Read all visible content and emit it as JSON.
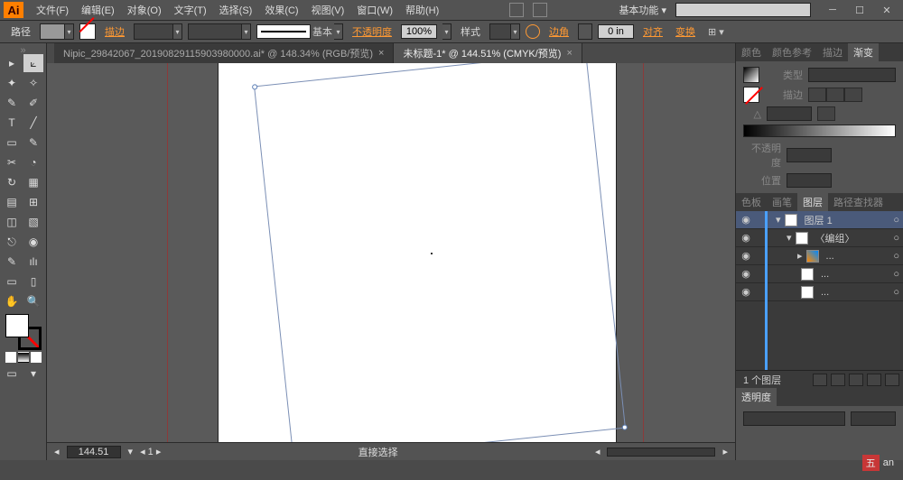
{
  "app": {
    "logo": "Ai"
  },
  "menu": {
    "items": [
      "文件(F)",
      "编辑(E)",
      "对象(O)",
      "文字(T)",
      "选择(S)",
      "效果(C)",
      "视图(V)",
      "窗口(W)",
      "帮助(H)"
    ],
    "workspace": "基本功能"
  },
  "options": {
    "label": "路径",
    "fill_link": "描边",
    "stroke_style": "基本",
    "opacity_label": "不透明度",
    "opacity": "100%",
    "style_label": "样式",
    "align_label": "边角",
    "align_val": "0 in",
    "align_link": "对齐",
    "transform_link": "变换"
  },
  "tabs": [
    {
      "label": "Nipic_29842067_20190829115903980000.ai* @ 148.34% (RGB/预览)",
      "active": false
    },
    {
      "label": "未标题-1* @ 144.51% (CMYK/预览)",
      "active": true
    }
  ],
  "status": {
    "zoom": "144.51",
    "tool": "直接选择"
  },
  "panels": {
    "color_tabs": [
      "颜色",
      "颜色参考",
      "描边",
      "渐变"
    ],
    "grad": {
      "type_label": "类型",
      "stroke_label": "描边"
    },
    "opacity_label": "不透明度",
    "position_label": "位置",
    "layer_tabs": [
      "色板",
      "画笔",
      "图层",
      "路径查找器"
    ],
    "layers": [
      {
        "name": "图层 1",
        "selected": true,
        "indent": 0,
        "expand": true
      },
      {
        "name": "〈编组〉",
        "selected": false,
        "indent": 1,
        "expand": true
      },
      {
        "name": "...",
        "selected": false,
        "indent": 2
      },
      {
        "name": "...",
        "selected": false,
        "indent": 2
      },
      {
        "name": "...",
        "selected": false,
        "indent": 2
      }
    ],
    "layer_count": "1 个图层",
    "bottom_tabs": [
      "透明度"
    ]
  },
  "watermark": {
    "brand": "五",
    "text": "an"
  },
  "tools": [
    [
      "▸",
      "⟀"
    ],
    [
      "✦",
      "✧"
    ],
    [
      "✎",
      "✐"
    ],
    [
      "T",
      "╱"
    ],
    [
      "▭",
      "✎"
    ],
    [
      "✂",
      "◔"
    ],
    [
      "↻",
      "▦"
    ],
    [
      "▤",
      "⊞"
    ],
    [
      "◫",
      "▧"
    ],
    [
      "⎋",
      "◉"
    ],
    [
      "✎",
      "ılı"
    ],
    [
      "▭",
      "▯"
    ],
    [
      "✋",
      "🔍"
    ]
  ]
}
